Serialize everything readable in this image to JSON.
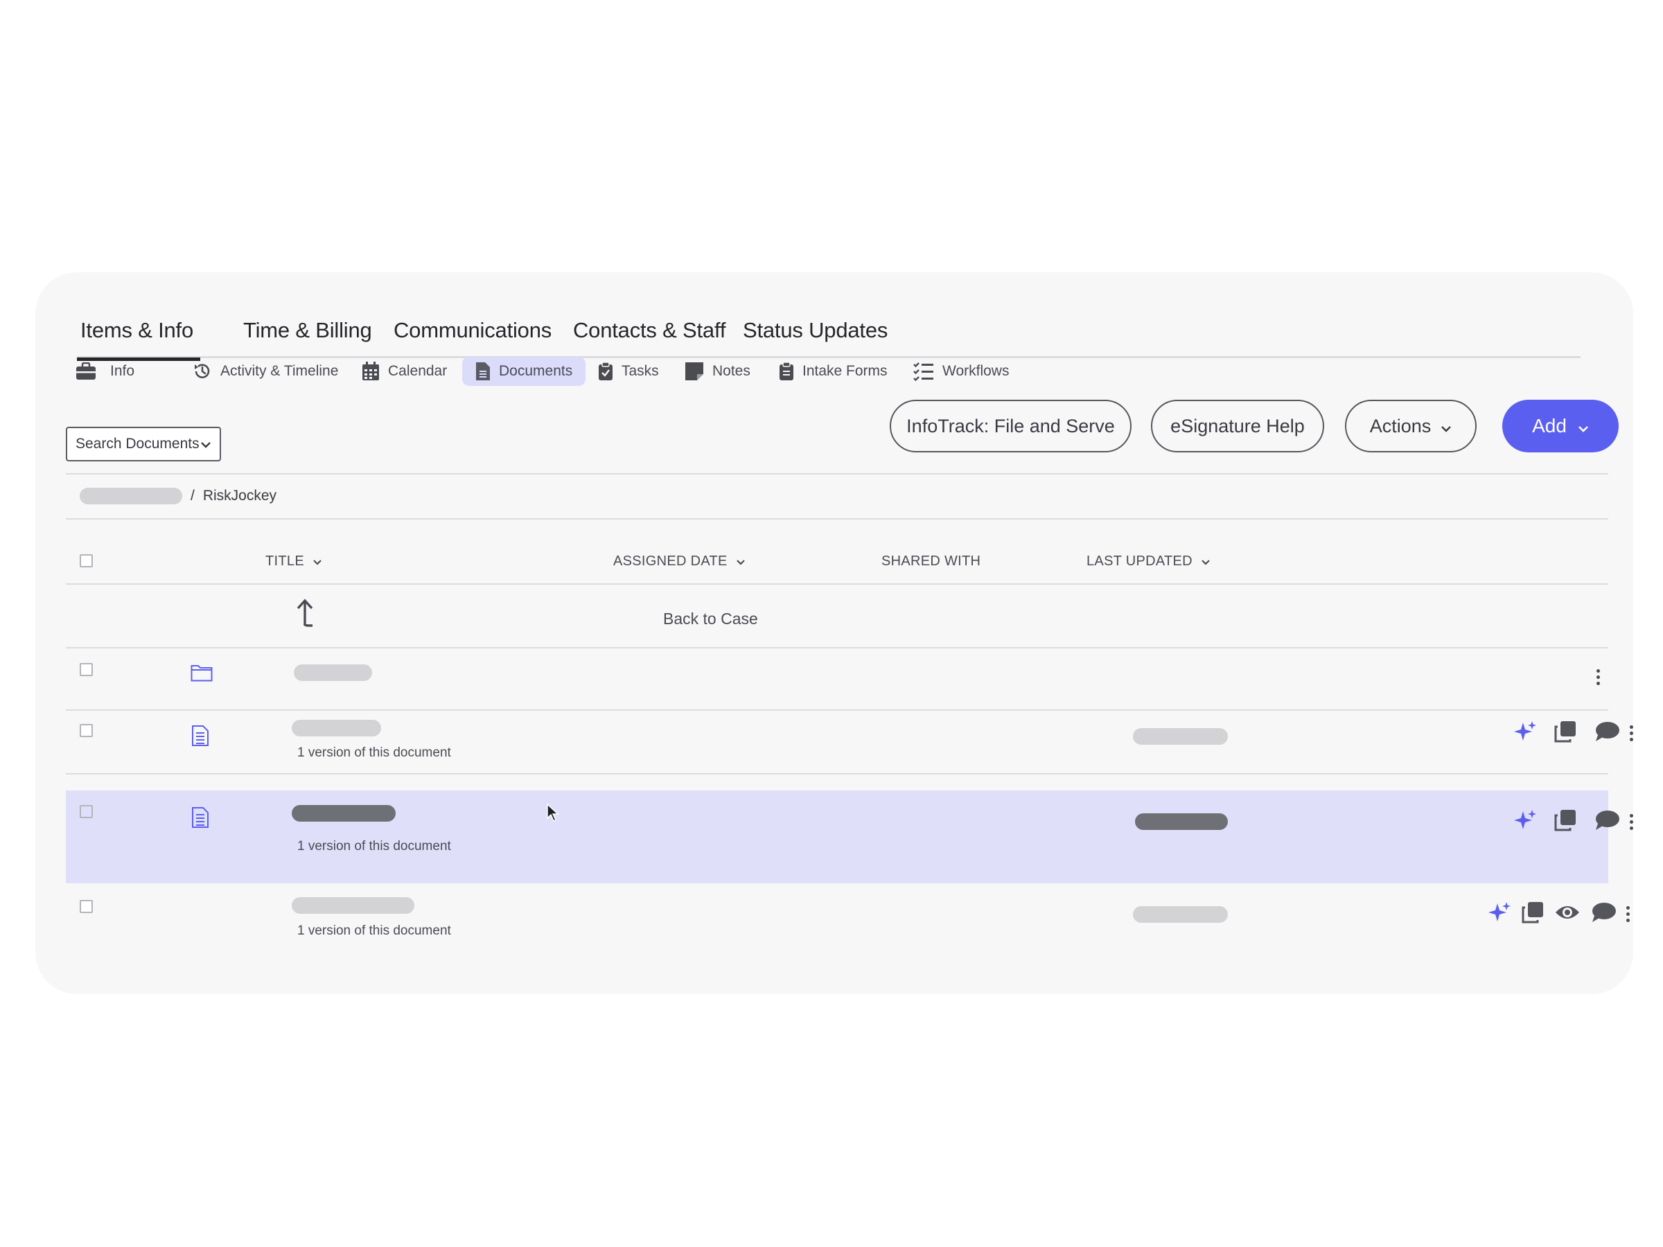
{
  "main_tabs": [
    {
      "label": "Items & Info",
      "active": true
    },
    {
      "label": "Time & Billing",
      "active": false
    },
    {
      "label": "Communications",
      "active": false
    },
    {
      "label": "Contacts & Staff",
      "active": false
    },
    {
      "label": "Status Updates",
      "active": false
    }
  ],
  "sub_nav": [
    {
      "label": "Info",
      "icon": "briefcase-icon",
      "active": false
    },
    {
      "label": "Activity & Timeline",
      "icon": "history-icon",
      "active": false
    },
    {
      "label": "Calendar",
      "icon": "calendar-icon",
      "active": false
    },
    {
      "label": "Documents",
      "icon": "document-icon",
      "active": true
    },
    {
      "label": "Tasks",
      "icon": "clipboard-check-icon",
      "active": false
    },
    {
      "label": "Notes",
      "icon": "note-icon",
      "active": false
    },
    {
      "label": "Intake Forms",
      "icon": "clipboard-icon",
      "active": false
    },
    {
      "label": "Workflows",
      "icon": "checklist-icon",
      "active": false
    }
  ],
  "toolbar": {
    "search_label": "Search Documents",
    "infotrack_label": "InfoTrack: File and Serve",
    "esignature_label": "eSignature Help",
    "actions_label": "Actions",
    "add_label": "Add"
  },
  "breadcrumb": {
    "separator": "/",
    "current": "RiskJockey"
  },
  "table": {
    "columns": {
      "title": "TITLE",
      "assigned_date": "ASSIGNED DATE",
      "shared_with": "SHARED WITH",
      "last_updated": "LAST UPDATED"
    },
    "back_label": "Back to Case",
    "rows": [
      {
        "type": "folder",
        "version_note": ""
      },
      {
        "type": "document",
        "version_note": "1 version of this document"
      },
      {
        "type": "document",
        "version_note": "1 version of this document",
        "selected": true
      },
      {
        "type": "document",
        "version_note": "1 version of this document"
      }
    ]
  },
  "colors": {
    "accent": "#5b5ff0",
    "selected_row": "#dfdffa",
    "active_subnav": "#dadcfa"
  }
}
